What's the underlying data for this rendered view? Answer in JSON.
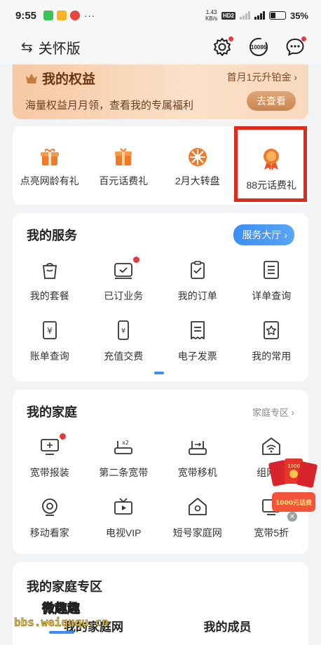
{
  "status_bar": {
    "time": "9:55",
    "more": "···",
    "speed_top": "1.43",
    "speed_bottom": "KB/s",
    "hd": "HD2",
    "battery_pct": "35%",
    "battery_level": 0.35
  },
  "header": {
    "title": "关怀版",
    "hotline": "10086"
  },
  "benefits": {
    "title": "我的权益",
    "link": "首月1元升铂金",
    "desc": "海量权益月月领，查看我的专属福利",
    "button": "去查看"
  },
  "promos": [
    {
      "label": "点亮网龄有礼",
      "icon": "gift-icon"
    },
    {
      "label": "百元话费礼",
      "icon": "gift-box-icon"
    },
    {
      "label": "2月大转盘",
      "icon": "wheel-icon"
    },
    {
      "label": "88元话费礼",
      "icon": "medal-icon"
    }
  ],
  "services": {
    "title": "我的服务",
    "hall_button": "服务大厅",
    "items": [
      {
        "label": "我的套餐",
        "icon": "bag-icon"
      },
      {
        "label": "已订业务",
        "icon": "subscription-icon"
      },
      {
        "label": "我的订单",
        "icon": "clipboard-icon"
      },
      {
        "label": "详单查询",
        "icon": "list-icon"
      },
      {
        "label": "账单查询",
        "icon": "bill-icon"
      },
      {
        "label": "充值交费",
        "icon": "phone-pay-icon"
      },
      {
        "label": "电子发票",
        "icon": "invoice-icon"
      },
      {
        "label": "我的常用",
        "icon": "star-doc-icon"
      }
    ]
  },
  "family": {
    "title": "我的家庭",
    "zone_link": "家庭专区",
    "items": [
      {
        "label": "宽带报装",
        "icon": "monitor-icon"
      },
      {
        "label": "第二条宽带",
        "icon": "router-x2-icon"
      },
      {
        "label": "宽带移机",
        "icon": "router-move-icon"
      },
      {
        "label": "组网小",
        "icon": "wifi-home-icon"
      },
      {
        "label": "移动看家",
        "icon": "camera-icon"
      },
      {
        "label": "电视VIP",
        "icon": "tv-icon"
      },
      {
        "label": "短号家庭网",
        "icon": "home-network-icon"
      },
      {
        "label": "宽带5折",
        "icon": "tv-discount-icon"
      }
    ],
    "ad_line1": "1000",
    "ad_line2": "1000元话费"
  },
  "zone": {
    "title": "我的家庭专区",
    "tabs": [
      "我的家庭网",
      "我的成员"
    ]
  },
  "watermark": {
    "cn": "微趣趣",
    "url": "bbs.weiququ.cn"
  },
  "colors": {
    "accent": "#3a8ef6",
    "highlight": "#e02a1c",
    "badge": "#e23b3b",
    "promo_orange": "#f07a2a"
  }
}
